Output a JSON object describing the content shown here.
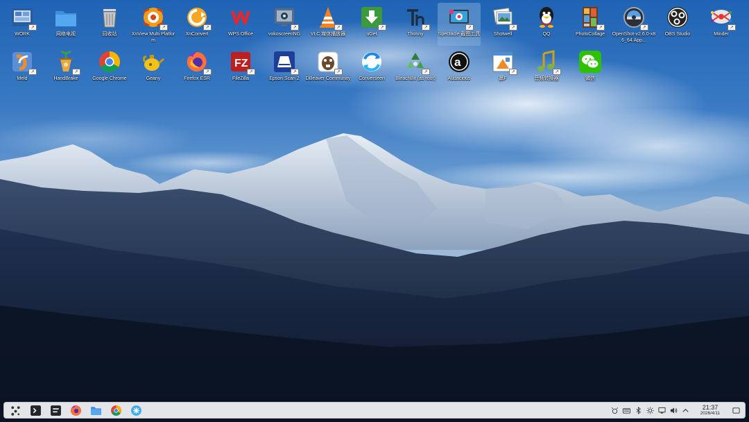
{
  "desktop": {
    "icons": [
      {
        "label": "WORK",
        "icon": "work-folder-icon"
      },
      {
        "label": "网络电视",
        "icon": "folder-icon"
      },
      {
        "label": "回收站",
        "icon": "trash-icon"
      },
      {
        "label": "XnView Multi Platform",
        "icon": "xnview-icon"
      },
      {
        "label": "XnConvert",
        "icon": "xnconvert-icon"
      },
      {
        "label": "WPS Office",
        "icon": "wps-office-icon"
      },
      {
        "label": "vokoscreenNG",
        "icon": "vokoscreen-icon"
      },
      {
        "label": "VLC 媒体播放器",
        "icon": "vlc-icon"
      },
      {
        "label": "uGet",
        "icon": "uget-icon"
      },
      {
        "label": "Thonny",
        "icon": "thonny-icon"
      },
      {
        "label": "Spectacle 截图工具",
        "icon": "spectacle-icon"
      },
      {
        "label": "Shotwell",
        "icon": "shotwell-icon"
      },
      {
        "label": "QQ",
        "icon": "qq-icon"
      },
      {
        "label": "PhotoCollage",
        "icon": "photocollage-icon"
      },
      {
        "label": "OpenShot-v2.6.0-x86_64.App...",
        "icon": "openshot-icon"
      },
      {
        "label": "OBS Studio",
        "icon": "obs-studio-icon"
      },
      {
        "label": "Minder",
        "icon": "minder-icon"
      },
      {
        "label": "Meld",
        "icon": "meld-icon"
      },
      {
        "label": "HandBrake",
        "icon": "handbrake-icon"
      },
      {
        "label": "Google Chrome",
        "icon": "google-chrome-icon"
      },
      {
        "label": "Geany",
        "icon": "geany-icon"
      },
      {
        "label": "Firefox ESR",
        "icon": "firefox-icon"
      },
      {
        "label": "FileZilla",
        "icon": "filezilla-icon"
      },
      {
        "label": "Epson Scan 2",
        "icon": "epson-scan-icon"
      },
      {
        "label": "DBeaver Community",
        "icon": "dbeaver-icon"
      },
      {
        "label": "Converseen",
        "icon": "converseen-icon"
      },
      {
        "label": "BleachBit (as root)",
        "icon": "bleachbit-icon"
      },
      {
        "label": "Audacious",
        "icon": "audacious-icon"
      },
      {
        "label": "赢F",
        "icon": "presenter-icon"
      },
      {
        "label": "音频转换器",
        "icon": "audio-converter-icon"
      },
      {
        "label": "微信",
        "icon": "wechat-icon"
      }
    ]
  },
  "taskbar": {
    "launchers": [
      {
        "name": "application-launcher",
        "icon": "app-launcher-icon"
      },
      {
        "name": "terminal",
        "icon": "terminal-icon"
      },
      {
        "name": "system-monitor",
        "icon": "system-monitor-icon"
      },
      {
        "name": "firefox",
        "icon": "firefox-icon"
      },
      {
        "name": "file-manager",
        "icon": "folder-icon"
      },
      {
        "name": "chrome",
        "icon": "google-chrome-icon"
      },
      {
        "name": "discover",
        "icon": "discover-icon"
      }
    ],
    "tray": [
      "input-method-icon",
      "keyboard-icon",
      "bluetooth-icon",
      "brightness-icon",
      "network-icon",
      "volume-icon",
      "tray-expand-icon"
    ],
    "clock": {
      "time": "21:37",
      "date": "2026/4/11"
    }
  },
  "colors": {
    "taskbar_bg": "#e3e5e8",
    "selection": "#8cb4dc"
  }
}
